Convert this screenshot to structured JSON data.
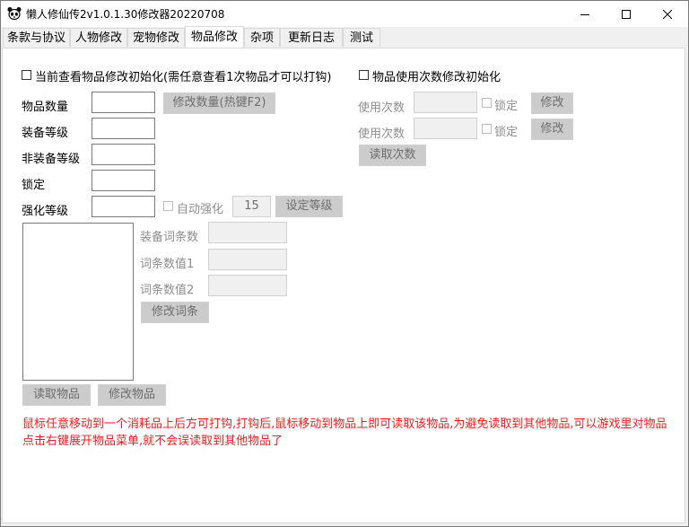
{
  "window": {
    "title": "懒人修仙传2v1.0.1.30修改器20220708",
    "controls": {
      "minimize": "minimize",
      "maximize": "maximize",
      "close": "close"
    }
  },
  "tabs": [
    {
      "label": "条款与协议",
      "active": false
    },
    {
      "label": "人物修改",
      "active": false
    },
    {
      "label": "宠物修改",
      "active": false
    },
    {
      "label": "物品修改",
      "active": true
    },
    {
      "label": "杂项",
      "active": false
    },
    {
      "label": "更新日志",
      "active": false
    },
    {
      "label": "测试",
      "active": false
    }
  ],
  "left": {
    "init_checkbox": {
      "label": "当前查看物品修改初始化(需任意查看1次物品才可以打钩)",
      "checked": false
    },
    "fields": {
      "quantity_label": "物品数量",
      "equip_level_label": "装备等级",
      "non_equip_level_label": "非装备等级",
      "lock_label": "锁定",
      "enhance_level_label": "强化等级"
    },
    "modify_quantity_button": "修改数量(热键F2)",
    "auto_enhance": {
      "label": "自动强化",
      "checked": false
    },
    "enhance_value": "15",
    "set_level_button": "设定等级",
    "affix": {
      "count_label": "装备词条数",
      "value1_label": "词条数值1",
      "value2_label": "词条数值2",
      "modify_button": "修改词条"
    },
    "read_item_button": "读取物品",
    "modify_item_button": "修改物品"
  },
  "right": {
    "init_checkbox": {
      "label": "物品使用次数修改初始化",
      "checked": false
    },
    "rows": [
      {
        "label": "使用次数",
        "lock_label": "锁定",
        "modify_button": "修改"
      },
      {
        "label": "使用次数",
        "lock_label": "锁定",
        "modify_button": "修改"
      }
    ],
    "read_count_button": "读取次数"
  },
  "note": "鼠标任意移动到一个消耗品上后方可打钩,打钩后,鼠标移动到物品上即可读取该物品,为避免读取到其他物品,可以游戏里对物品点击右键展开物品菜单,就不会误读取到其他物品了",
  "colors": {
    "note_text": "#ff1a1a",
    "disabled_button": "#cccccc",
    "disabled_text": "#6d6d6d"
  }
}
